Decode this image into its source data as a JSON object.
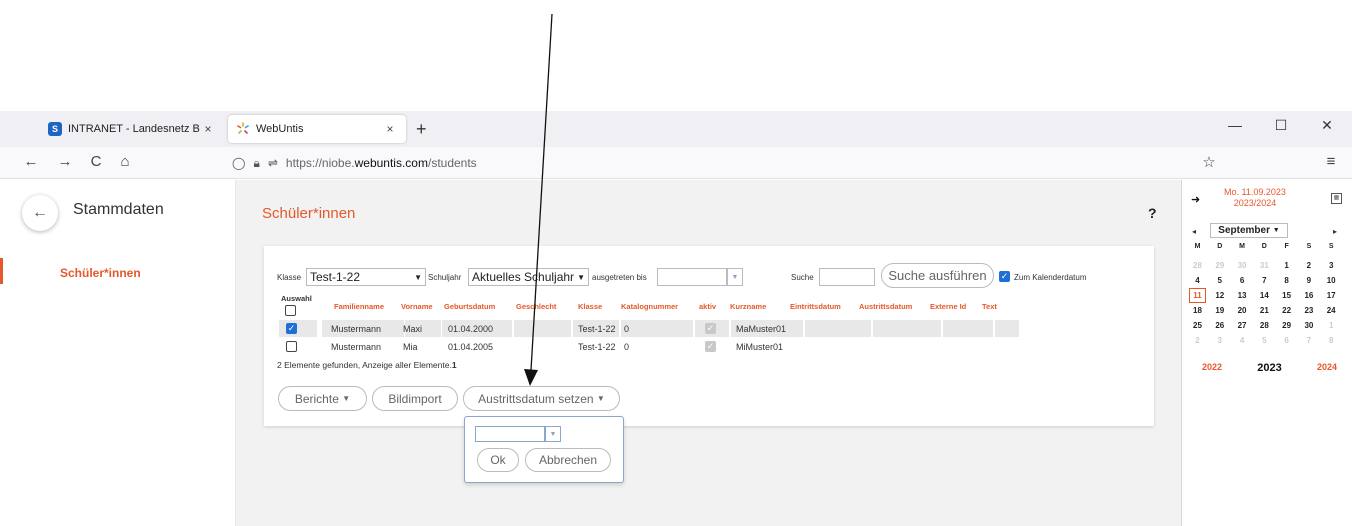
{
  "browser": {
    "tabs": [
      {
        "title": "INTRANET - Landesnetz Bildung",
        "favicon": "intranet-favicon",
        "close": "×"
      },
      {
        "title": "WebUntis",
        "favicon": "webuntis-favicon",
        "close": "×"
      }
    ],
    "new_tab": "+",
    "window_controls": {
      "minimize": "—",
      "maximize": "☐",
      "close": "✕"
    },
    "nav": {
      "back": "←",
      "forward": "→",
      "reload": "C",
      "home": "⌂"
    },
    "url_prefix": "https://niobe.",
    "url_domain": "webuntis.com",
    "url_path": "/students",
    "bookmark_icon": "☆",
    "menu_icon": "≡"
  },
  "sidebar": {
    "back_icon": "←",
    "title": "Stammdaten",
    "items": [
      {
        "label": "Schüler*innen",
        "selected": true
      }
    ]
  },
  "main": {
    "title": "Schüler*innen",
    "help": "?",
    "filters": {
      "klasse_label": "Klasse",
      "klasse_value": "Test-1-22",
      "schuljahr_label": "Schuljahr",
      "schuljahr_value": "Aktuelles Schuljahr",
      "ausgetreten_label": "ausgetreten bis",
      "ausgetreten_value": "",
      "suche_label": "Suche",
      "suche_value": "",
      "suche_button": "Suche ausführen",
      "kalender_label": "Zum Kalenderdatum",
      "kalender_checked": true
    },
    "table": {
      "columns": [
        "Auswahl",
        "Familienname",
        "Vorname",
        "Geburtsdatum",
        "Geschlecht",
        "Klasse",
        "Katalognummer",
        "aktiv",
        "Kurzname",
        "Eintrittsdatum",
        "Austrittsdatum",
        "Externe Id",
        "Text"
      ],
      "rows": [
        {
          "selected": true,
          "familienname": "Mustermann",
          "vorname": "Maxi",
          "geburtsdatum": "01.04.2000",
          "geschlecht": "",
          "klasse": "Test-1-22",
          "katalognummer": "0",
          "aktiv": true,
          "kurzname": "MaMuster01",
          "eintrittsdatum": "",
          "austrittsdatum": "",
          "externe_id": "",
          "text": ""
        },
        {
          "selected": false,
          "familienname": "Mustermann",
          "vorname": "Mia",
          "geburtsdatum": "01.04.2005",
          "geschlecht": "",
          "klasse": "Test-1-22",
          "katalognummer": "0",
          "aktiv": true,
          "kurzname": "MiMuster01",
          "eintrittsdatum": "",
          "austrittsdatum": "",
          "externe_id": "",
          "text": ""
        }
      ]
    },
    "summary_prefix": "2 Elemente gefunden, Anzeige aller Elemente.",
    "summary_count": "1",
    "actions": {
      "berichte": "Berichte",
      "bildimport": "Bildimport",
      "austrittsdatum": "Austrittsdatum setzen"
    },
    "popup": {
      "date_value": "",
      "ok": "Ok",
      "cancel": "Abbrechen"
    }
  },
  "calendar": {
    "nav_arrow": "➜",
    "date_line": "Mo. 11.09.2023",
    "school_year": "2023/2024",
    "month": "September",
    "prev": "◂",
    "next": "▸",
    "weekday_headers": [
      "M",
      "D",
      "M",
      "D",
      "F",
      "S",
      "S"
    ],
    "weeks": [
      [
        "28",
        "29",
        "30",
        "31",
        "1",
        "2",
        "3"
      ],
      [
        "4",
        "5",
        "6",
        "7",
        "8",
        "9",
        "10"
      ],
      [
        "11",
        "12",
        "13",
        "14",
        "15",
        "16",
        "17"
      ],
      [
        "18",
        "19",
        "20",
        "21",
        "22",
        "23",
        "24"
      ],
      [
        "25",
        "26",
        "27",
        "28",
        "29",
        "30",
        "1"
      ],
      [
        "2",
        "3",
        "4",
        "5",
        "6",
        "7",
        "8"
      ]
    ],
    "muted_cells": [
      [
        0,
        0
      ],
      [
        0,
        1
      ],
      [
        0,
        2
      ],
      [
        0,
        3
      ],
      [
        4,
        6
      ],
      [
        5,
        0
      ],
      [
        5,
        1
      ],
      [
        5,
        2
      ],
      [
        5,
        3
      ],
      [
        5,
        4
      ],
      [
        5,
        5
      ],
      [
        5,
        6
      ]
    ],
    "today_cell": [
      2,
      0
    ],
    "years": [
      "2022",
      "2023",
      "2024"
    ],
    "current_year_index": 1,
    "accent": "#e5582b"
  },
  "colors": {
    "accent": "#e5582b",
    "checkbox_blue": "#1f6fd6"
  }
}
